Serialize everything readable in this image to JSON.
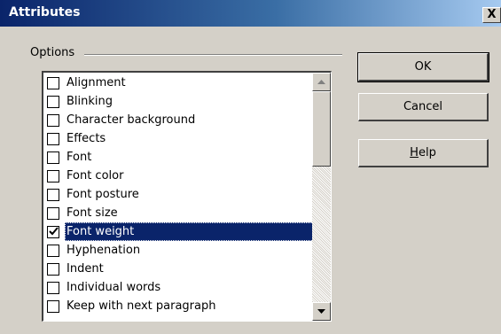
{
  "window": {
    "title": "Attributes",
    "close_glyph": "X"
  },
  "options": {
    "group_label": "Options",
    "items": [
      {
        "label": "Alignment",
        "checked": false,
        "selected": false
      },
      {
        "label": "Blinking",
        "checked": false,
        "selected": false
      },
      {
        "label": "Character background",
        "checked": false,
        "selected": false
      },
      {
        "label": "Effects",
        "checked": false,
        "selected": false
      },
      {
        "label": "Font",
        "checked": false,
        "selected": false
      },
      {
        "label": "Font color",
        "checked": false,
        "selected": false
      },
      {
        "label": "Font posture",
        "checked": false,
        "selected": false
      },
      {
        "label": "Font size",
        "checked": false,
        "selected": false
      },
      {
        "label": "Font weight",
        "checked": true,
        "selected": true
      },
      {
        "label": "Hyphenation",
        "checked": false,
        "selected": false
      },
      {
        "label": "Indent",
        "checked": false,
        "selected": false
      },
      {
        "label": "Individual words",
        "checked": false,
        "selected": false
      },
      {
        "label": "Keep with next paragraph",
        "checked": false,
        "selected": false
      }
    ]
  },
  "buttons": {
    "ok_label": "OK",
    "cancel_label": "Cancel",
    "help_label_underlined": "H",
    "help_label_rest": "elp"
  },
  "colors": {
    "selection": "#0a246a",
    "title_gradient_start": "#0a246a",
    "face": "#d4d0c8"
  }
}
